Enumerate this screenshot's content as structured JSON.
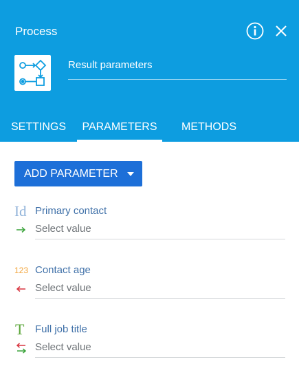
{
  "header": {
    "title": "Process",
    "element_name": "Result parameters",
    "icons": {
      "info": "info-circle-icon",
      "close": "close-icon",
      "element": "process-element-icon"
    }
  },
  "tabs": [
    {
      "label": "SETTINGS",
      "active": false
    },
    {
      "label": "PARAMETERS",
      "active": true
    },
    {
      "label": "METHODS",
      "active": false
    }
  ],
  "toolbar": {
    "add_parameter_label": "ADD PARAMETER"
  },
  "parameters": [
    {
      "type_icon": "Id",
      "type_name": "id-type-icon",
      "label": "Primary contact",
      "direction": "input-arrow-icon",
      "value_placeholder": "Select value"
    },
    {
      "type_icon": "123",
      "type_name": "number-type-icon",
      "label": "Contact age",
      "direction": "output-arrow-icon",
      "value_placeholder": "Select value"
    },
    {
      "type_icon": "T",
      "type_name": "text-type-icon",
      "label": "Full job title",
      "direction": "bidirectional-arrow-icon",
      "value_placeholder": "Select value"
    }
  ],
  "colors": {
    "header_bg": "#0d9de0",
    "primary_button": "#1d6fd8",
    "label_blue": "#3f70a8",
    "arrow_green": "#3aa33a",
    "arrow_red": "#d8343f",
    "type_id_blue": "#8fb2d9",
    "type_number_orange": "#f2a43a",
    "type_text_green": "#5aa538"
  }
}
